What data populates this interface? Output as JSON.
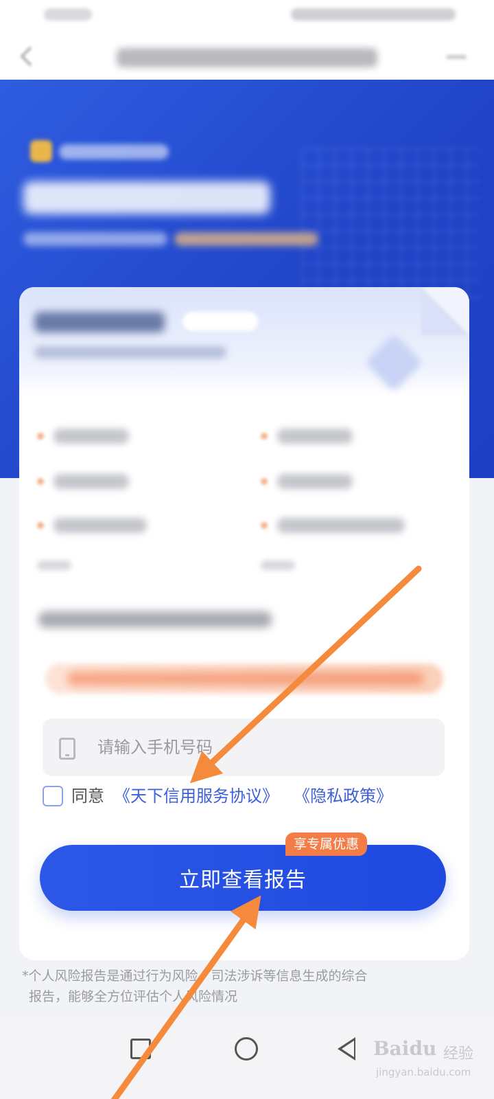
{
  "form": {
    "phone_placeholder": "请输入手机号码",
    "agree_prefix": "同意",
    "agreement_link": "《天下信用服务协议》",
    "privacy_link": "《隐私政策》"
  },
  "cta": {
    "button_label": "立即查看报告",
    "badge": "享专属优惠"
  },
  "footnote": {
    "line1": "*个人风险报告是通过行为风险、司法涉诉等信息生成的综合",
    "line2": "报告，能够全方位评估个人风险情况"
  },
  "watermark": {
    "logo": "Baidu",
    "label": "经验",
    "url": "jingyan.baidu.com"
  },
  "annotation": {
    "arrow_color": "#f58a3c"
  }
}
